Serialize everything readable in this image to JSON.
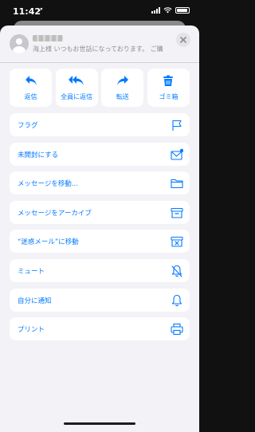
{
  "status_bar": {
    "time": "11:42",
    "location_icon": "location-arrow-icon",
    "icons": [
      "signal-icon",
      "wifi-icon",
      "battery-icon"
    ]
  },
  "header": {
    "avatar_icon": "person-icon",
    "preview": "海上様 いつもお世話になっております。 ご購",
    "close_icon": "close-icon"
  },
  "actions": [
    {
      "label": "返信",
      "icon": "reply-icon"
    },
    {
      "label": "全員に返信",
      "icon": "reply-all-icon"
    },
    {
      "label": "転送",
      "icon": "forward-icon"
    },
    {
      "label": "ゴミ箱",
      "icon": "trash-icon"
    }
  ],
  "menu": [
    {
      "label": "フラグ",
      "icon": "flag-icon"
    },
    {
      "label": "未開封にする",
      "icon": "unread-envelope-icon"
    },
    {
      "label": "メッセージを移動...",
      "icon": "folder-icon"
    },
    {
      "label": "メッセージをアーカイブ",
      "icon": "archive-box-icon"
    },
    {
      "label": "“迷惑メール”に移動",
      "icon": "junk-box-icon"
    },
    {
      "label": "ミュート",
      "icon": "bell-slash-icon"
    },
    {
      "label": "自分に通知",
      "icon": "bell-icon"
    },
    {
      "label": "プリント",
      "icon": "printer-icon"
    }
  ],
  "colors": {
    "accent": "#007aff",
    "sheet_bg": "#f2f2f7",
    "row_bg": "#ffffff",
    "backdrop": "#111111"
  }
}
